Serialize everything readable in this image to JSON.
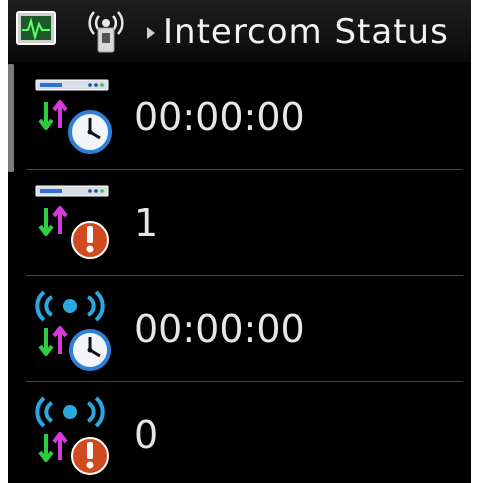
{
  "header": {
    "title": "Intercom Status",
    "icons": [
      "monitor-icon",
      "intercom-icon",
      "breadcrumb-arrow-icon"
    ]
  },
  "rows": [
    {
      "icon": "network-device-clock-icon",
      "value": "00:00:00"
    },
    {
      "icon": "network-device-alert-icon",
      "value": "1"
    },
    {
      "icon": "wireless-clock-icon",
      "value": "00:00:00"
    },
    {
      "icon": "wireless-alert-icon",
      "value": "0"
    }
  ],
  "colors": {
    "background": "#000000",
    "text": "#e6e6e6",
    "separator": "#444444",
    "arrow_down": "#2ecc40",
    "arrow_up": "#d43bd8",
    "wireless": "#2aa8e0",
    "alert": "#d14a1f",
    "clock": "#2f7fd8"
  }
}
